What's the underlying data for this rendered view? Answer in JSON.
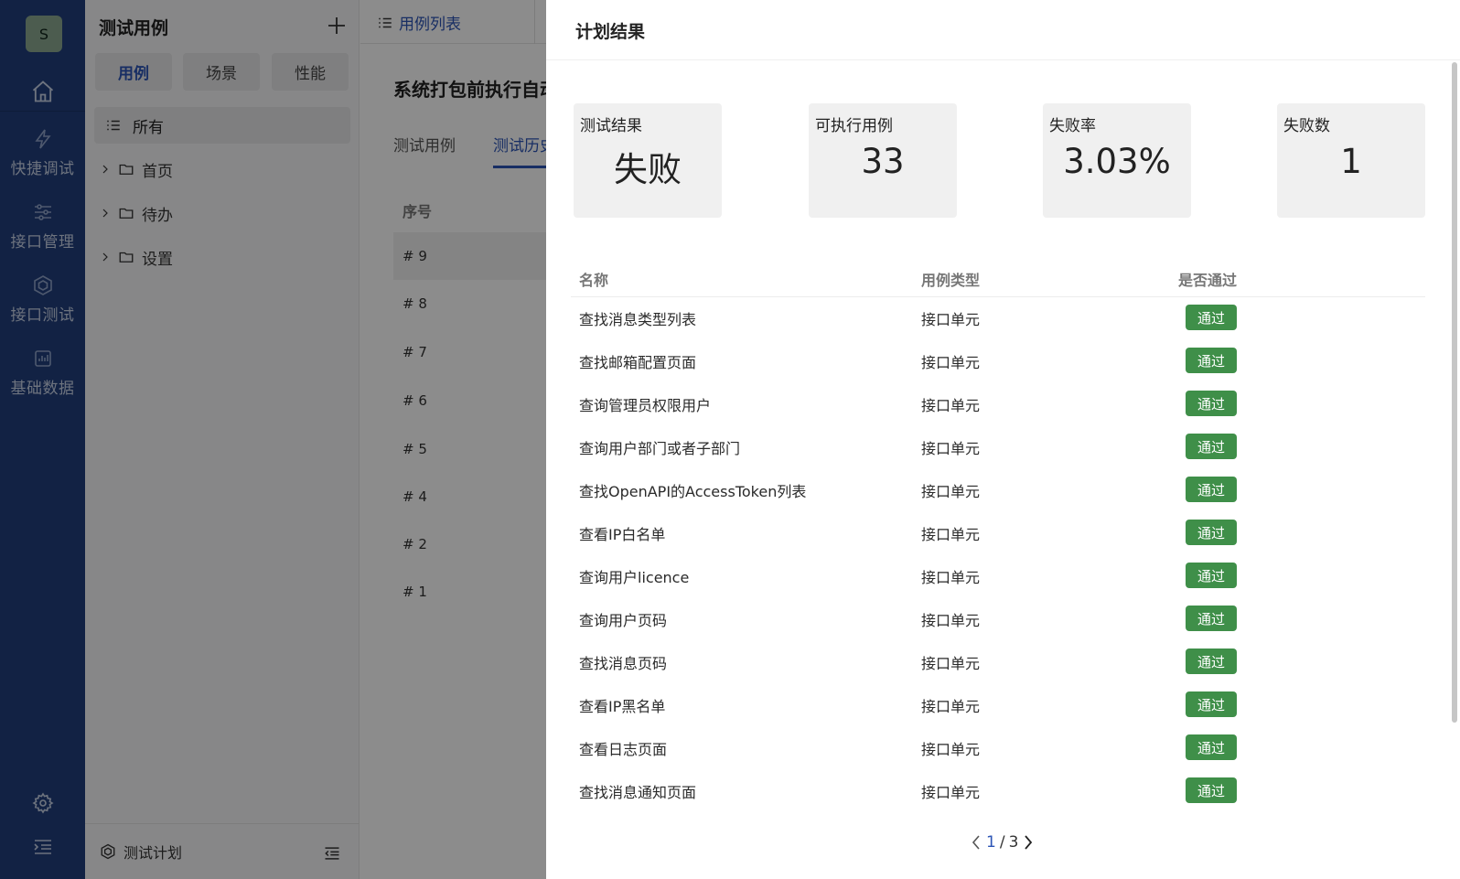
{
  "rail": {
    "avatar_letter": "S",
    "items": [
      {
        "label": "快捷调试",
        "icon": "lightning-icon"
      },
      {
        "label": "接口管理",
        "icon": "sliders-icon"
      },
      {
        "label": "接口测试",
        "icon": "cube-icon"
      },
      {
        "label": "基础数据",
        "icon": "chart-icon"
      }
    ]
  },
  "sidebar": {
    "title": "测试用例",
    "segments": [
      "用例",
      "场景",
      "性能"
    ],
    "all_label": "所有",
    "folders": [
      "首页",
      "待办",
      "设置"
    ],
    "footer_label": "测试计划"
  },
  "main": {
    "tab_label": "用例列表",
    "title": "系统打包前执行自动",
    "subtabs": [
      "测试用例",
      "测试历史"
    ],
    "column_header": "序号",
    "history": [
      "# 9",
      "# 8",
      "# 7",
      "# 6",
      "# 5",
      "# 4",
      "# 2",
      "# 1"
    ]
  },
  "drawer": {
    "title": "计划结果",
    "stats": [
      {
        "label": "测试结果",
        "value": "失败"
      },
      {
        "label": "可执行用例",
        "value": "33"
      },
      {
        "label": "失败率",
        "value": "3.03%"
      },
      {
        "label": "失败数",
        "value": "1"
      }
    ],
    "columns": [
      "名称",
      "用例类型",
      "是否通过"
    ],
    "rows": [
      {
        "name": "查找消息类型列表",
        "type": "接口单元",
        "status": "通过"
      },
      {
        "name": "查找邮箱配置页面",
        "type": "接口单元",
        "status": "通过"
      },
      {
        "name": "查询管理员权限用户",
        "type": "接口单元",
        "status": "通过"
      },
      {
        "name": "查询用户部门或者子部门",
        "type": "接口单元",
        "status": "通过"
      },
      {
        "name": "查找OpenAPI的AccessToken列表",
        "type": "接口单元",
        "status": "通过"
      },
      {
        "name": "查看IP白名单",
        "type": "接口单元",
        "status": "通过"
      },
      {
        "name": "查询用户licence",
        "type": "接口单元",
        "status": "通过"
      },
      {
        "name": "查询用户页码",
        "type": "接口单元",
        "status": "通过"
      },
      {
        "name": "查找消息页码",
        "type": "接口单元",
        "status": "通过"
      },
      {
        "name": "查看IP黑名单",
        "type": "接口单元",
        "status": "通过"
      },
      {
        "name": "查看日志页面",
        "type": "接口单元",
        "status": "通过"
      },
      {
        "name": "查找消息通知页面",
        "type": "接口单元",
        "status": "通过"
      }
    ],
    "pager": {
      "current": "1",
      "separator": "/",
      "total": "3"
    }
  },
  "colors": {
    "rail_bg": "#223f7d",
    "accent": "#2c55b6",
    "pass_badge": "#3f8f49"
  }
}
